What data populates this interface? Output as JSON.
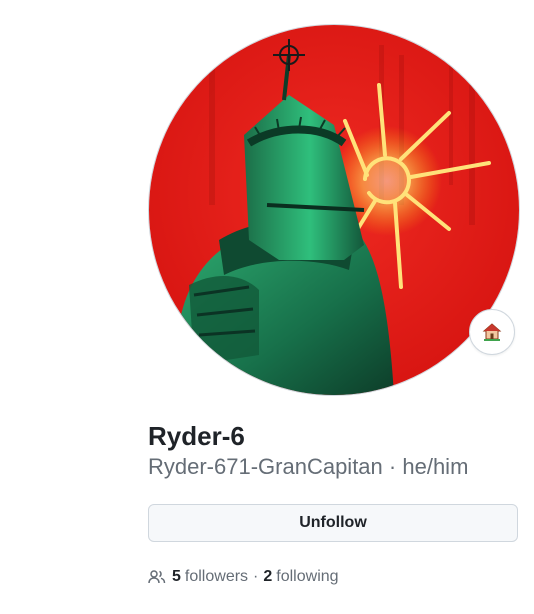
{
  "profile": {
    "full_name": "Ryder-6",
    "login": "Ryder-671-GranCapitan",
    "separator": "·",
    "pronouns": "he/him",
    "avatar_icon": "knight-avatar-image",
    "status_icon": "house-emoji-icon"
  },
  "actions": {
    "unfollow_label": "Unfollow"
  },
  "stats": {
    "followers_count": "5",
    "followers_label": "followers",
    "dot": "·",
    "following_count": "2",
    "following_label": "following",
    "icon": "people-icon"
  },
  "colors": {
    "avatar_background": "#e01b1b",
    "knight_green": "#1f8a5a",
    "halo": "#ffd54a",
    "button_bg": "#f6f8fa",
    "border": "#d0d7de",
    "muted_text": "#656d76"
  }
}
